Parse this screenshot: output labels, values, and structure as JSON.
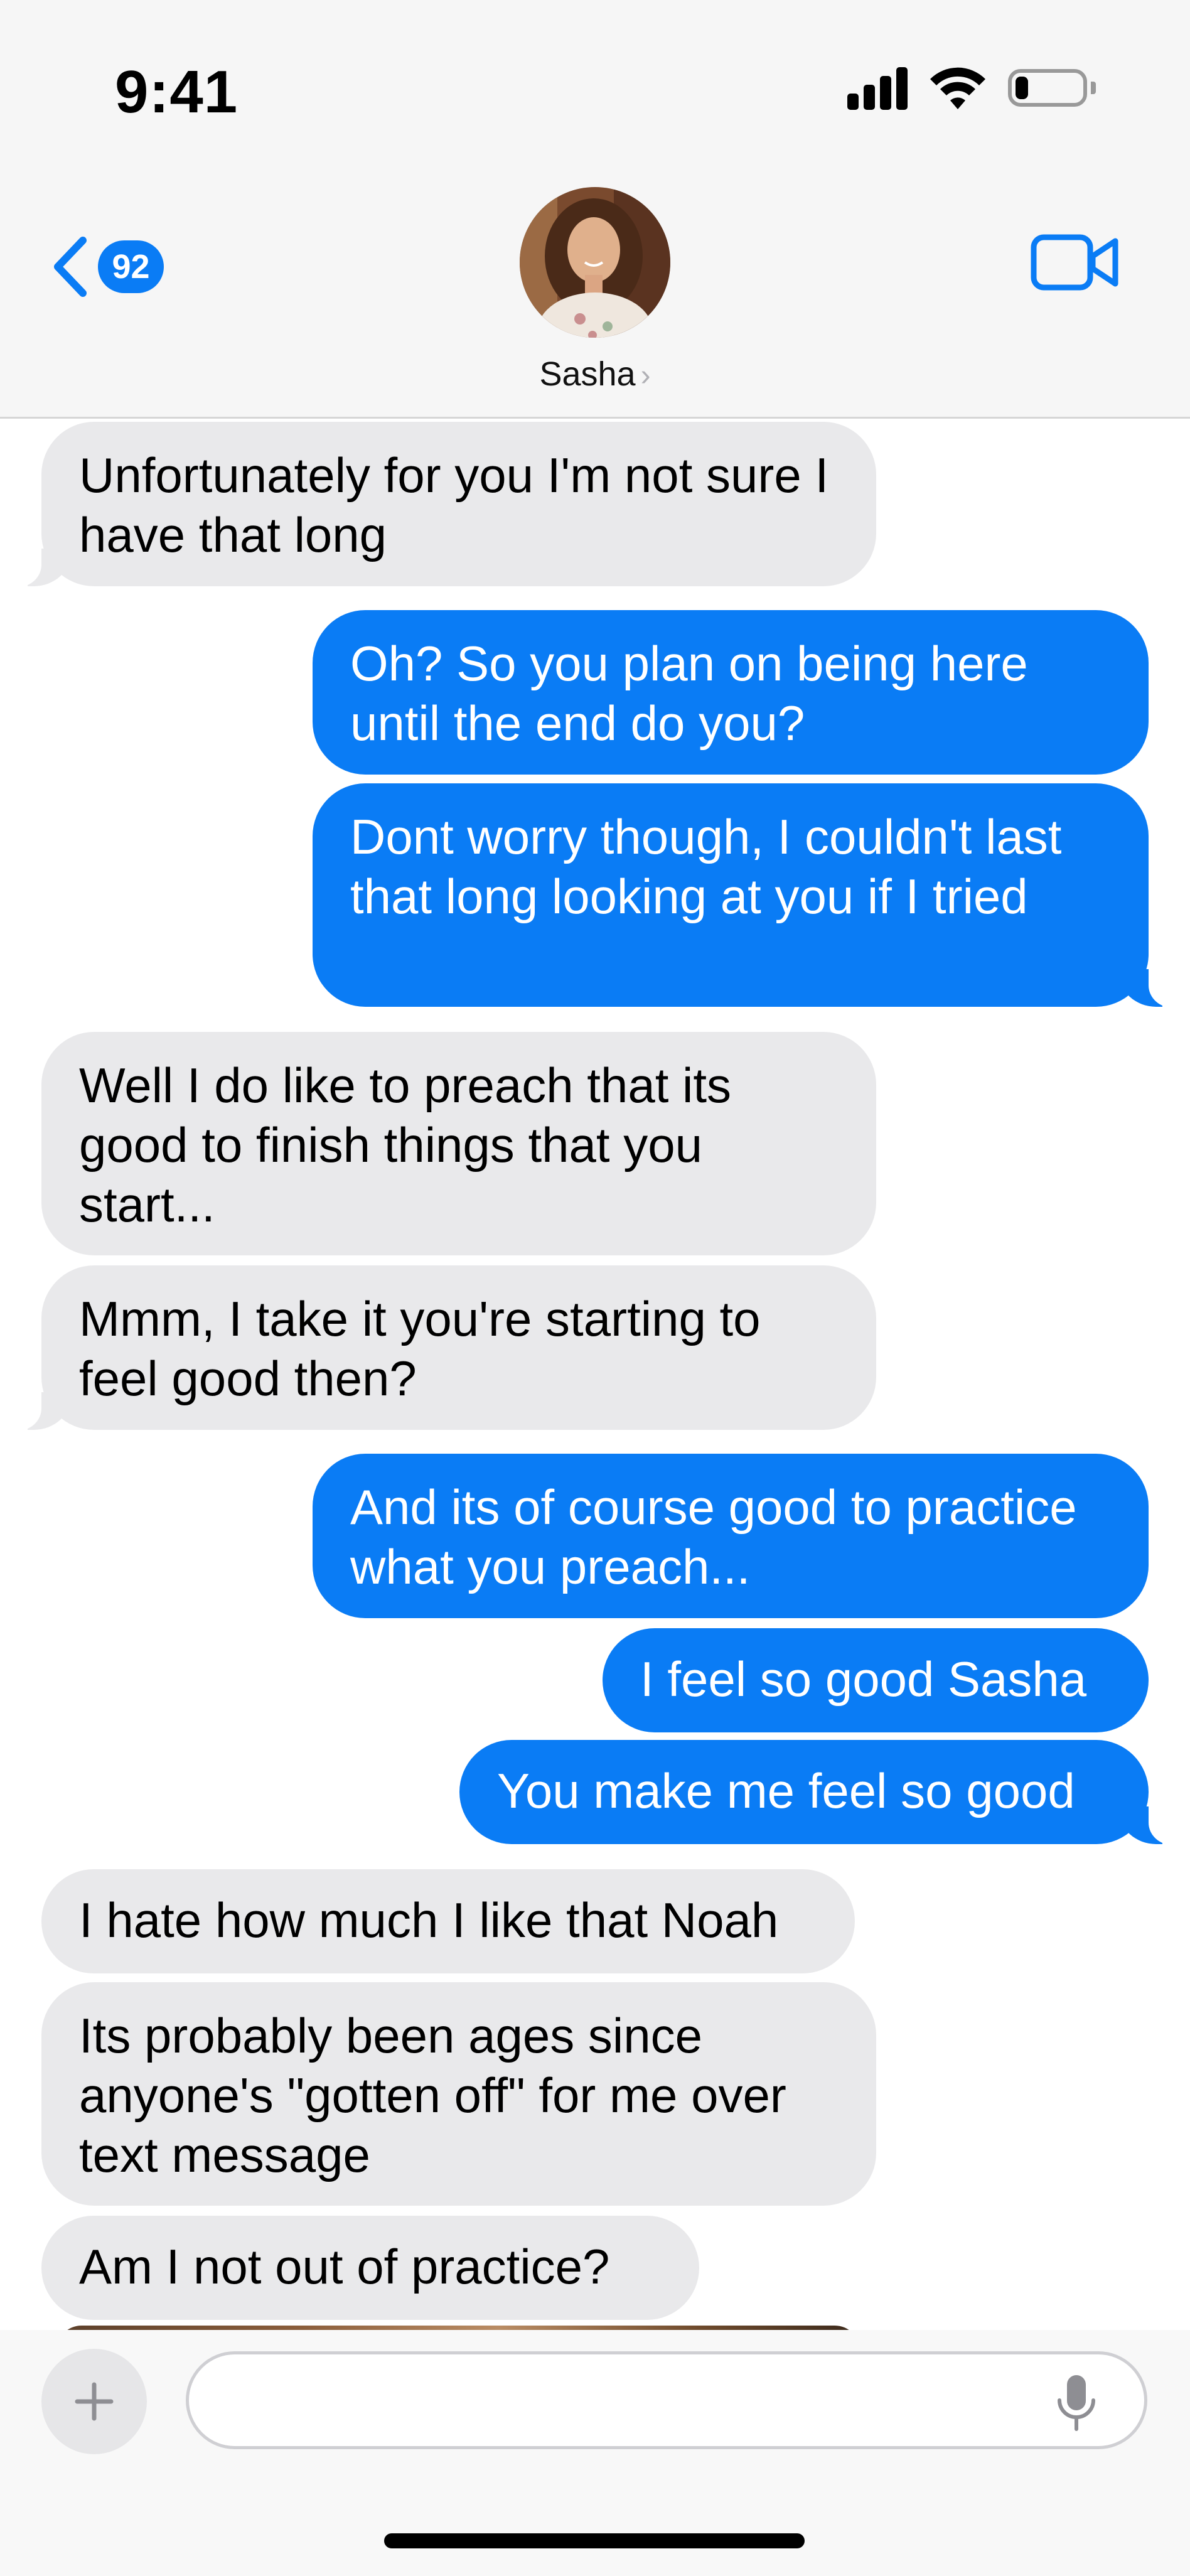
{
  "status_bar": {
    "time": "9:41",
    "icons": [
      "cellular-signal-icon",
      "wifi-icon",
      "battery-icon"
    ],
    "battery_level": 0.2
  },
  "header": {
    "back_badge": "92",
    "contact_name": "Sasha",
    "name_chevron": "›",
    "icons": [
      "back-chevron-icon",
      "contact-avatar",
      "video-call-icon"
    ]
  },
  "messages": [
    {
      "from": "Sasha",
      "direction": "received",
      "text": "Unfortunately for you I'm not sure I have that long"
    },
    {
      "from": "me",
      "direction": "sent",
      "text": "Oh? So you plan on being here until the end do you?"
    },
    {
      "from": "me",
      "direction": "sent",
      "text": "Dont worry though, I couldn't last that long looking at you if I tried"
    },
    {
      "from": "Sasha",
      "direction": "received",
      "text": "Well I do like to preach that its good to finish things that you start..."
    },
    {
      "from": "Sasha",
      "direction": "received",
      "text": "Mmm, I take it you're starting to feel good then?"
    },
    {
      "from": "me",
      "direction": "sent",
      "text": "And its of course good to practice what you preach..."
    },
    {
      "from": "me",
      "direction": "sent",
      "text": "I feel so good Sasha"
    },
    {
      "from": "me",
      "direction": "sent",
      "text": "You make me feel so good"
    },
    {
      "from": "Sasha",
      "direction": "received",
      "text": "I hate how much I like that Noah"
    },
    {
      "from": "Sasha",
      "direction": "received",
      "text": "Its probably been ages since anyone's \"gotten off\" for me over text message"
    },
    {
      "from": "Sasha",
      "direction": "received",
      "text": "Am I not out of practice?"
    }
  ],
  "composer": {
    "value": "",
    "placeholder": "",
    "icons": [
      "plus-icon",
      "microphone-icon"
    ]
  },
  "colors": {
    "sent_bubble": "#0a7cf5",
    "received_bubble": "#e9e9eb",
    "accent": "#0a7cf5",
    "header_bg": "#f6f6f6"
  }
}
